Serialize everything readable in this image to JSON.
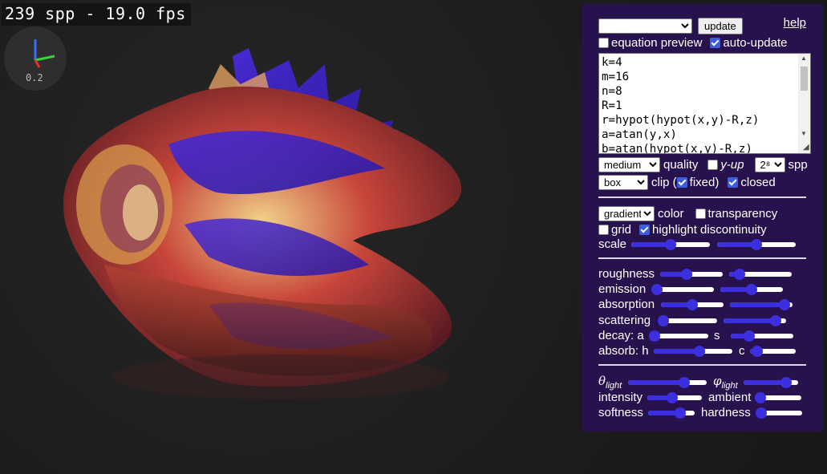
{
  "overlay": {
    "fps_text": "239 spp - 19.0 fps",
    "axes_scale": "0.2"
  },
  "panel": {
    "preset_select": "",
    "update_label": "update",
    "help_label": "help",
    "equation_preview": {
      "label": "equation preview",
      "checked": false
    },
    "auto_update": {
      "label": "auto-update",
      "checked": true
    },
    "equation_text": "k=4\nm=16\nn=8\nR=1\nr=hypot(hypot(x,y)-R,z)\na=atan(y,x)\nb=atan(hypot(x,y)-R,z)",
    "quality": {
      "value": "medium",
      "label": "quality"
    },
    "y_up": {
      "label": "y-up",
      "checked": false
    },
    "spp": {
      "value": "2⁸",
      "label": "spp"
    },
    "clip": {
      "value": "box",
      "label": "clip (",
      "fixed_label": "fixed)",
      "fixed_checked": true,
      "closed_label": "closed",
      "closed_checked": true
    },
    "color": {
      "value": "gradient",
      "label": "color"
    },
    "transparency": {
      "label": "transparency",
      "checked": false
    },
    "grid": {
      "label": "grid",
      "checked": false
    },
    "highlight": {
      "label": "highlight discontinuity",
      "checked": true
    },
    "scale_label": "scale",
    "roughness_label": "roughness",
    "emission_label": "emission",
    "absorption_label": "absorption",
    "scattering_label": "scattering",
    "decay_a_label": "decay: a",
    "decay_s_label": "s",
    "absorb_h_label": "absorb: h",
    "absorb_c_label": "c",
    "theta_label": "θ",
    "theta_sub": "light",
    "phi_label": "φ",
    "phi_sub": "light",
    "intensity_label": "intensity",
    "ambient_label": "ambient",
    "softness_label": "softness",
    "hardness_label": "hardness",
    "slider_values": {
      "scale_1": 0.5,
      "scale_2": 0.5,
      "roughness_1": 0.4,
      "roughness_2": 0.1,
      "emission_1": 0.0,
      "emission_2": 0.5,
      "absorption_1": 0.5,
      "absorption_2": 0.95,
      "scattering_1": 0.0,
      "scattering_2": 0.9,
      "decay_a": 0.0,
      "decay_s": 0.25,
      "absorb_h": 0.6,
      "absorb_c": 0.05,
      "theta_light": 0.75,
      "phi_light": 0.85,
      "intensity": 0.45,
      "ambient": 0.0,
      "softness": 0.75,
      "hardness": 0.0
    }
  },
  "colors": {
    "panel_bg": "#28124e",
    "accent": "#3b2fe0"
  }
}
